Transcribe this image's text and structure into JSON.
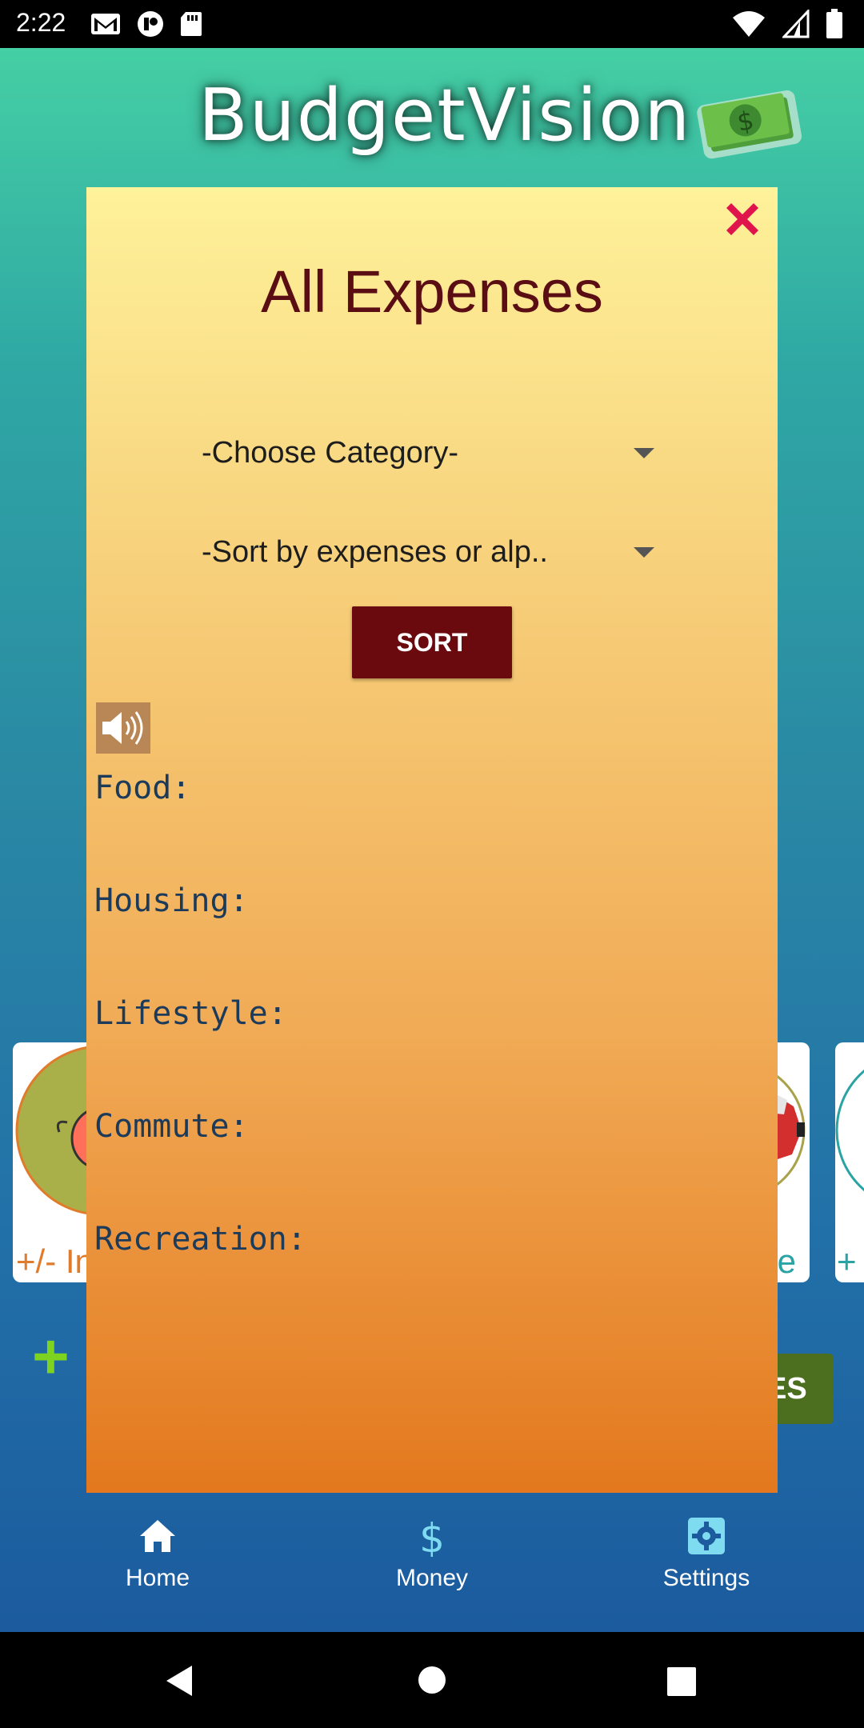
{
  "status_bar": {
    "time": "2:22",
    "left_icons": [
      "gmail-icon",
      "app-notification-icon",
      "sd-card-icon"
    ],
    "right_icons": [
      "wifi-icon",
      "cell-signal-icon",
      "battery-icon"
    ]
  },
  "app": {
    "title": "BudgetVision",
    "logo_icon": "money-bill-icon"
  },
  "background": {
    "left_card_text": "+/- In",
    "right_card_text": "te",
    "far_card_text": "+",
    "green_button_text": "ES"
  },
  "modal": {
    "title": "All Expenses",
    "category_dropdown": "-Choose Category-",
    "sort_dropdown": "-Sort by expenses or alp..",
    "sort_button": "SORT",
    "categories": [
      {
        "label": "Food:"
      },
      {
        "label": "Housing:"
      },
      {
        "label": "Lifestyle:"
      },
      {
        "label": "Commute:"
      },
      {
        "label": "Recreation:"
      }
    ],
    "close_color": "#e0144c"
  },
  "bottom_nav": {
    "items": [
      {
        "label": "Home",
        "icon": "home-icon"
      },
      {
        "label": "Money",
        "icon": "dollar-icon"
      },
      {
        "label": "Settings",
        "icon": "gear-icon"
      }
    ]
  },
  "system_nav": [
    "back-icon",
    "home-circle-icon",
    "recents-icon"
  ]
}
